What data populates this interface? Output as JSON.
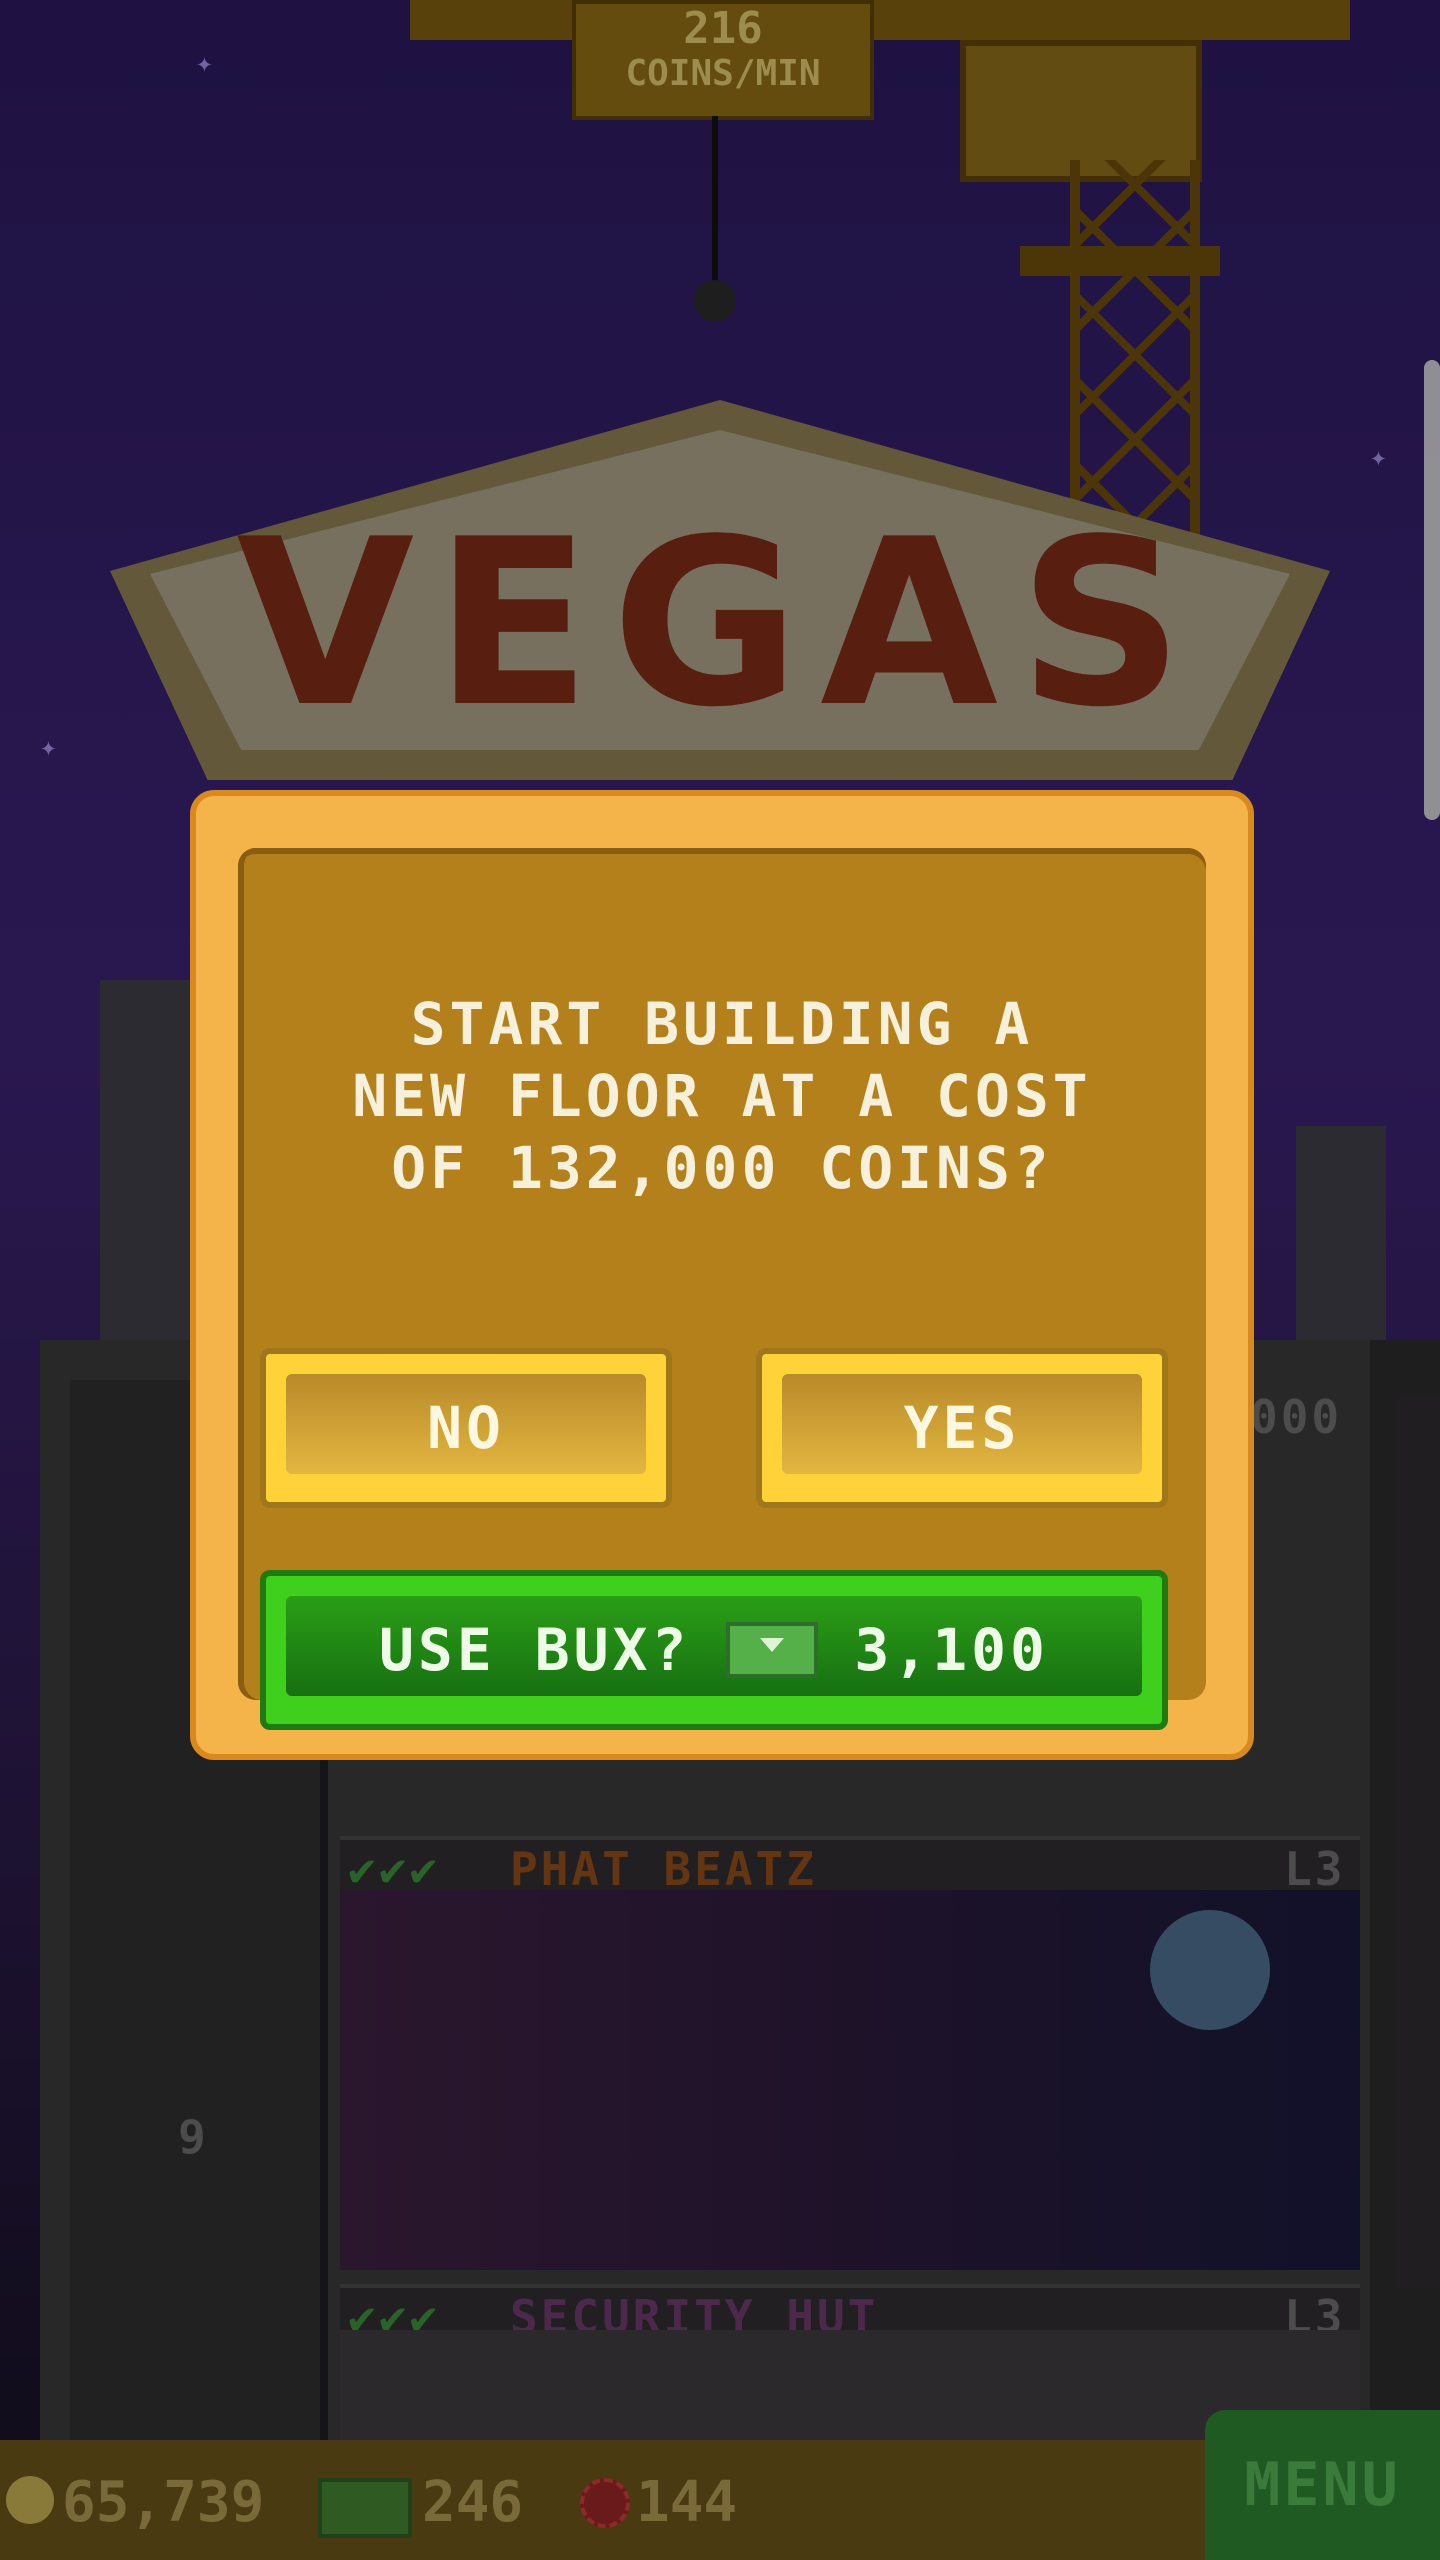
{
  "hud": {
    "coins_rate_value": "216",
    "coins_rate_unit": "COINS/MIN",
    "coins": "65,739",
    "bux": "246",
    "chips": "144",
    "menu_label": "MENU"
  },
  "sign_text": "VEGAS",
  "tower": {
    "floors": [
      {
        "name": "PHAT BEATZ",
        "level": "L3"
      },
      {
        "name": "SECURITY HUT",
        "level": "L3"
      }
    ],
    "elevator_floor": "9",
    "partial_value": "000"
  },
  "dialog": {
    "message": "START BUILDING A NEW FLOOR AT A COST OF 132,000 COINS?",
    "no_label": "NO",
    "yes_label": "YES",
    "bux_label": "USE BUX?",
    "bux_cost": "3,100"
  },
  "colors": {
    "dialog_border": "#f4b44a",
    "dialog_body": "#b3801c",
    "yes_no_button": "#ffd23a",
    "bux_button": "#3ed01c"
  },
  "icons": [
    "coin-icon",
    "bux-icon",
    "chip-icon",
    "cash-icon"
  ]
}
